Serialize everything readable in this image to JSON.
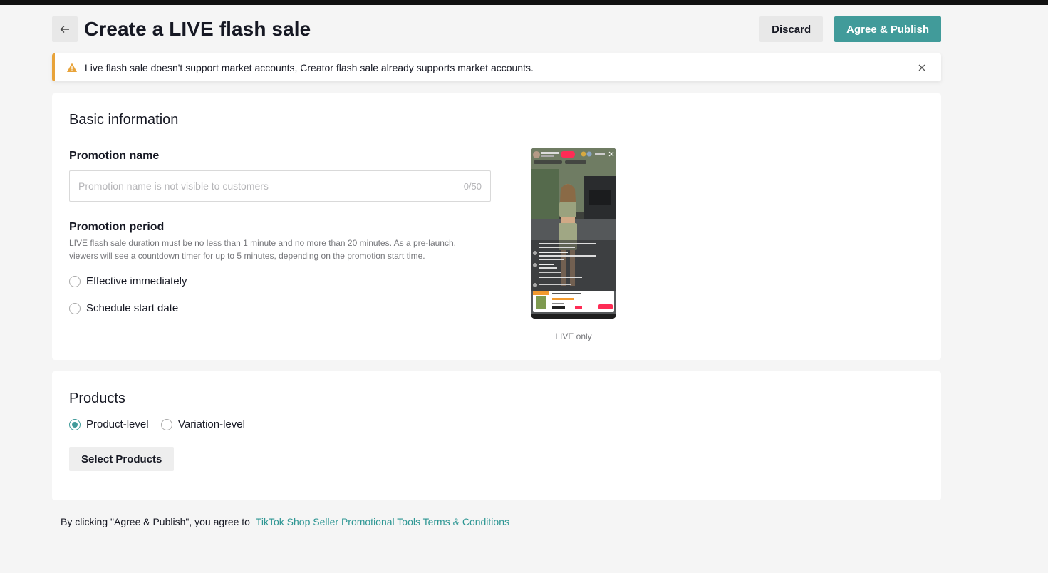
{
  "header": {
    "title": "Create a LIVE flash sale",
    "discard_label": "Discard",
    "publish_label": "Agree & Publish"
  },
  "alert": {
    "message": "Live flash sale doesn't support market accounts, Creator flash sale already supports market accounts."
  },
  "basic": {
    "heading": "Basic information",
    "promotion_name_label": "Promotion name",
    "promotion_name_placeholder": "Promotion name is not visible to customers",
    "promotion_name_value": "",
    "promotion_name_counter": "0/50",
    "period_label": "Promotion period",
    "period_description": "LIVE flash sale duration must be no less than 1 minute and no more than 20 minutes. As a pre-launch, viewers will see a countdown timer for up to 5 minutes, depending on the promotion start time.",
    "options": [
      "Effective immediately",
      "Schedule start date"
    ],
    "preview_caption": "LIVE only"
  },
  "products": {
    "heading": "Products",
    "levels": [
      "Product-level",
      "Variation-level"
    ],
    "selected_level": "Product-level",
    "select_button": "Select Products"
  },
  "footer": {
    "terms_prefix": "By clicking \"Agree & Publish\", you agree to",
    "terms_link": "TikTok Shop Seller Promotional Tools Terms & Conditions"
  },
  "colors": {
    "accent": "#419b9a",
    "warning": "#e8a33a",
    "link": "#2d9693",
    "sale_tag": "#fe2c55"
  }
}
